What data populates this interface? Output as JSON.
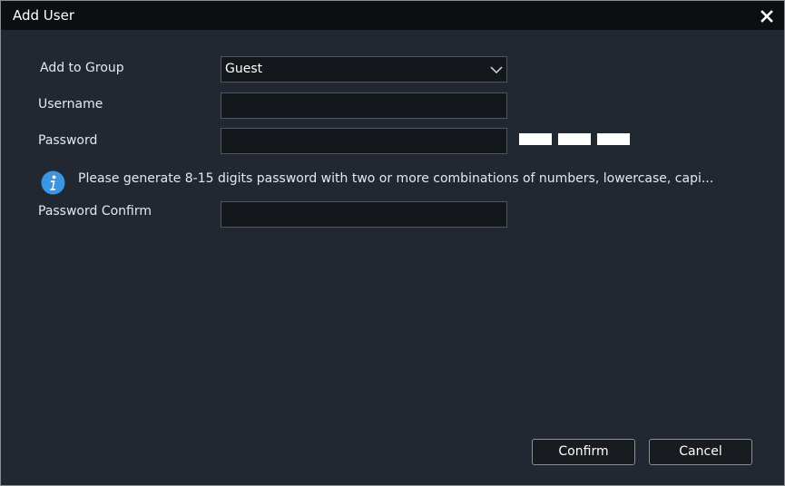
{
  "dialog": {
    "title": "Add User",
    "close_icon": "close-icon"
  },
  "form": {
    "group_label": "Add to Group",
    "group_value": "Guest",
    "username_label": "Username",
    "username_value": "",
    "password_label": "Password",
    "password_value": "",
    "confirm_label": "Password Confirm",
    "confirm_value": ""
  },
  "hint": {
    "icon": "info-icon",
    "text": "Please generate 8-15 digits password with two or more combinations of numbers, lowercase, capi..."
  },
  "buttons": {
    "confirm": "Confirm",
    "cancel": "Cancel"
  },
  "colors": {
    "background": "#212831",
    "titlebar": "#0c0f12",
    "info_accent": "#3b95e3"
  }
}
